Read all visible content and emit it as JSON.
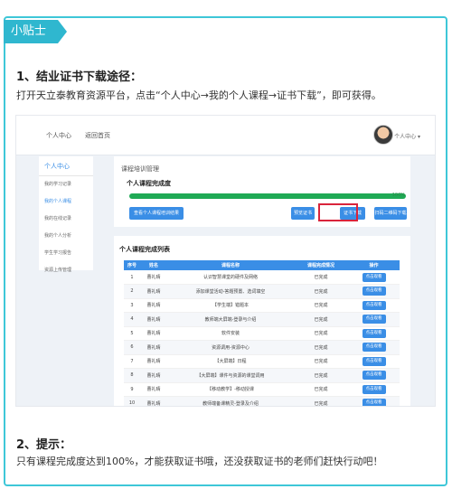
{
  "tag": "小贴士",
  "section1": {
    "heading": "1、结业证书下载途径：",
    "text": "打开天立泰教育资源平台，点击“个人中心→我的个人课程→证书下载”，即可获得。"
  },
  "screenshot": {
    "topnav": [
      "个人中心",
      "返回首页"
    ],
    "user_menu": "个人中心 ▾",
    "sidebar": {
      "heading": "个人中心",
      "items": [
        "我的学习记录",
        "我的个人课程",
        "我的在线记录",
        "我的个人分析",
        "学生学习报告",
        "资源上传管理"
      ],
      "active_index": 1
    },
    "panel": {
      "crumb": "课程培训管理",
      "title": "个人课程完成度",
      "progress_label": "100%",
      "progress_value": 1.0,
      "buttons": [
        "查看个人课程培训结果",
        "预览证书",
        "证书下载",
        "扫码二维码下载"
      ]
    },
    "list": {
      "title": "个人课程完成列表",
      "columns": [
        "序号",
        "姓名",
        "课程名称",
        "课程完成情况",
        "操作"
      ],
      "rows": [
        [
          "1",
          "曹礼晴",
          "认识智慧课堂的硬件及网络",
          "已完成",
          "点击观看"
        ],
        [
          "2",
          "曹礼晴",
          "添加课堂活动-答题预置、选词填空",
          "已完成",
          "点击观看"
        ],
        [
          "3",
          "曹礼晴",
          "【学生端】错题本",
          "已完成",
          "点击观看"
        ],
        [
          "4",
          "曹礼晴",
          "教师端大屏端-登录与介绍",
          "已完成",
          "点击观看"
        ],
        [
          "5",
          "曹礼晴",
          "软件安装",
          "已完成",
          "点击观看"
        ],
        [
          "6",
          "曹礼晴",
          "资源调用-资源中心",
          "已完成",
          "点击观看"
        ],
        [
          "7",
          "曹礼晴",
          "【大屏端】日程",
          "已完成",
          "点击观看"
        ],
        [
          "8",
          "曹礼晴",
          "【大屏端】课件与资源的课堂调用",
          "已完成",
          "点击观看"
        ],
        [
          "9",
          "曹礼晴",
          "【移动教学】-移动授课",
          "已完成",
          "点击观看"
        ],
        [
          "10",
          "曹礼晴",
          "教师端备课精灵-登录及介绍",
          "已完成",
          "点击观看"
        ]
      ]
    }
  },
  "section2": {
    "heading": "2、提示：",
    "text": "只有课程完成度达到100%，才能获取证书哦，还没获取证书的老师们赶快行动吧！"
  }
}
